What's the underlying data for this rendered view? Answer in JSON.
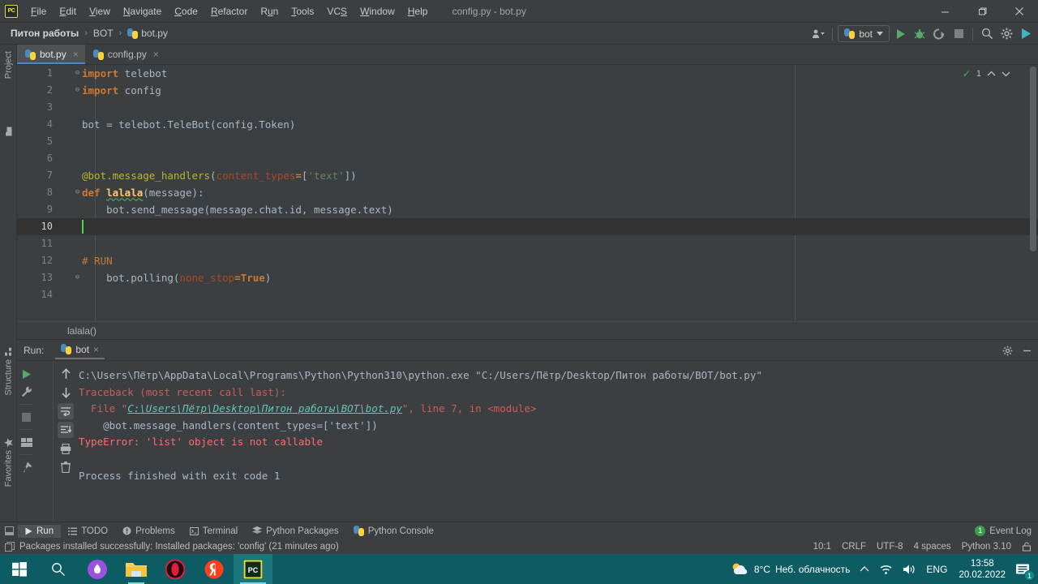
{
  "titlebar": {
    "app_icon": "pycharm-logo-icon",
    "logo_text": "PC",
    "menu": [
      "File",
      "Edit",
      "View",
      "Navigate",
      "Code",
      "Refactor",
      "Run",
      "Tools",
      "VCS",
      "Window",
      "Help"
    ],
    "window_title": "config.py - bot.py",
    "controls": {
      "minimize": "minimize-icon",
      "maximize": "maximize-icon",
      "close": "close-icon"
    }
  },
  "navbar": {
    "breadcrumbs": [
      "Питон работы",
      "BOT",
      "bot.py"
    ],
    "separator": "›",
    "run_config": "bot",
    "buttons": [
      "run-button",
      "debug-button",
      "run-coverage-button",
      "stop-button",
      "search-everywhere-button",
      "settings-button",
      "updates-button"
    ]
  },
  "left_strip": {
    "tabs": [
      "Project",
      "Structure",
      "Favorites"
    ]
  },
  "editor_tabs": [
    {
      "label": "bot.py",
      "active": true,
      "close": "×"
    },
    {
      "label": "config.py",
      "active": false,
      "close": "×"
    }
  ],
  "editor": {
    "caret_line": 10,
    "inspection_count": "1",
    "breadcrumb": "lalala()",
    "lines": [
      {
        "n": "1",
        "fold": "⊖",
        "tokens": [
          {
            "t": "import",
            "c": "kw"
          },
          {
            "t": " telebot",
            "c": "txt"
          }
        ]
      },
      {
        "n": "2",
        "fold": "⊖",
        "tokens": [
          {
            "t": "import",
            "c": "kw"
          },
          {
            "t": " config",
            "c": "txt"
          }
        ]
      },
      {
        "n": "3",
        "fold": "",
        "tokens": []
      },
      {
        "n": "4",
        "fold": "",
        "tokens": [
          {
            "t": "bot = telebot.TeleBot(config.Token)",
            "c": "txt"
          }
        ]
      },
      {
        "n": "5",
        "fold": "",
        "tokens": []
      },
      {
        "n": "6",
        "fold": "",
        "tokens": []
      },
      {
        "n": "7",
        "fold": "",
        "tokens": [
          {
            "t": "@bot.message_handlers",
            "c": "deco"
          },
          {
            "t": "(",
            "c": "brk"
          },
          {
            "t": "content_types",
            "c": "param"
          },
          {
            "t": "=",
            "c": "kw"
          },
          {
            "t": "[",
            "c": "brk"
          },
          {
            "t": "'text'",
            "c": "str"
          },
          {
            "t": "]",
            "c": "brk"
          },
          {
            "t": ")",
            "c": "brk"
          }
        ]
      },
      {
        "n": "8",
        "fold": "⊖",
        "tokens": [
          {
            "t": "def",
            "c": "kw"
          },
          {
            "t": " ",
            "c": "txt"
          },
          {
            "t": "lalala",
            "c": "fn"
          },
          {
            "t": "(message):",
            "c": "txt"
          }
        ]
      },
      {
        "n": "9",
        "fold": "",
        "tokens": [
          {
            "t": "    bot.send_message(message.chat.id, message.text)",
            "c": "txt"
          }
        ]
      },
      {
        "n": "10",
        "fold": "",
        "tokens": []
      },
      {
        "n": "11",
        "fold": "",
        "tokens": []
      },
      {
        "n": "12",
        "fold": "",
        "tokens": [
          {
            "t": "# RUN",
            "c": "cmt"
          }
        ]
      },
      {
        "n": "13",
        "fold": "⊖",
        "tokens": [
          {
            "t": "    bot.polling(",
            "c": "txt"
          },
          {
            "t": "none_stop",
            "c": "param"
          },
          {
            "t": "=",
            "c": "kw"
          },
          {
            "t": "True",
            "c": "kw"
          },
          {
            "t": ")",
            "c": "brk"
          }
        ]
      },
      {
        "n": "14",
        "fold": "",
        "tokens": []
      }
    ]
  },
  "run_window": {
    "label": "Run:",
    "tab": "bot",
    "tab_close": "×",
    "header_buttons": [
      "settings-gear-icon",
      "hide-icon"
    ],
    "tools_left": [
      "rerun-button",
      "settings-wrench-button",
      "stop-button",
      "layout-button",
      "pin-button"
    ],
    "tools_right": [
      "scroll-up-button",
      "scroll-down-button",
      "soft-wrap-button",
      "scroll-to-end-button",
      "print-button",
      "clear-all-button"
    ],
    "console": [
      {
        "parts": [
          {
            "t": "C:\\Users\\Пётр\\AppData\\Local\\Programs\\Python\\Python310\\python.exe \"C:/Users/Пётр/Desktop/Питон работы/BOT/bot.py\"",
            "c": "c-normal"
          }
        ]
      },
      {
        "parts": [
          {
            "t": "Traceback (most recent call last):",
            "c": "c-err-dim"
          }
        ]
      },
      {
        "parts": [
          {
            "t": "  File \"",
            "c": "c-err-dim"
          },
          {
            "t": "C:\\Users\\Пётр\\Desktop\\Питон работы\\BOT\\bot.py",
            "c": "c-link"
          },
          {
            "t": "\", line 7, in <module>",
            "c": "c-err-dim"
          }
        ]
      },
      {
        "parts": [
          {
            "t": "    @bot.message_handlers(content_types=['text'])",
            "c": "c-normal"
          }
        ]
      },
      {
        "parts": [
          {
            "t": "TypeError: 'list' object is not callable",
            "c": "c-err"
          }
        ]
      },
      {
        "parts": [
          {
            "t": "",
            "c": "c-normal"
          }
        ]
      },
      {
        "parts": [
          {
            "t": "Process finished with exit code 1",
            "c": "c-normal"
          }
        ]
      }
    ]
  },
  "bottom_bar": {
    "items": [
      {
        "label": "Run",
        "icon": "run-triangle-icon",
        "active": true
      },
      {
        "label": "TODO",
        "icon": "todo-list-icon",
        "active": false
      },
      {
        "label": "Problems",
        "icon": "problems-icon",
        "active": false
      },
      {
        "label": "Terminal",
        "icon": "terminal-icon",
        "active": false
      },
      {
        "label": "Python Packages",
        "icon": "packages-icon",
        "active": false
      },
      {
        "label": "Python Console",
        "icon": "python-console-icon",
        "active": false
      }
    ],
    "event_log": {
      "label": "Event Log",
      "count": "1"
    }
  },
  "status_bar": {
    "message": "Packages installed successfully: Installed packages: 'config' (21 minutes ago)",
    "message_icon": "notification-icon",
    "caret_position": "10:1",
    "line_separator": "CRLF",
    "encoding": "UTF-8",
    "indent": "4 spaces",
    "interpreter": "Python 3.10",
    "lock_icon": "lock-icon"
  },
  "taskbar": {
    "start": "windows-start-icon",
    "search": "search-icon",
    "apps": [
      {
        "name": "cortana-icon"
      },
      {
        "name": "file-explorer-icon"
      },
      {
        "name": "opera-gx-icon"
      },
      {
        "name": "yandex-browser-icon"
      },
      {
        "name": "pycharm-icon"
      }
    ],
    "tray": {
      "weather_icon": "partly-cloudy-icon",
      "temperature": "8°C",
      "weather_text": "Неб. облачность",
      "chevron": "show-hidden-icons-icon",
      "wifi": "wifi-icon",
      "volume": "volume-icon",
      "language": "ENG",
      "time": "13:58",
      "date": "20.02.2022",
      "notifications_badge": "1"
    }
  },
  "colors": {
    "accent_blue": "#4a88c7",
    "ide_bg": "#3c3f41",
    "editor_bg": "#3c3f41",
    "taskbar": "#0d5c63",
    "error_red": "#ff6b68",
    "run_green": "#59a869"
  }
}
